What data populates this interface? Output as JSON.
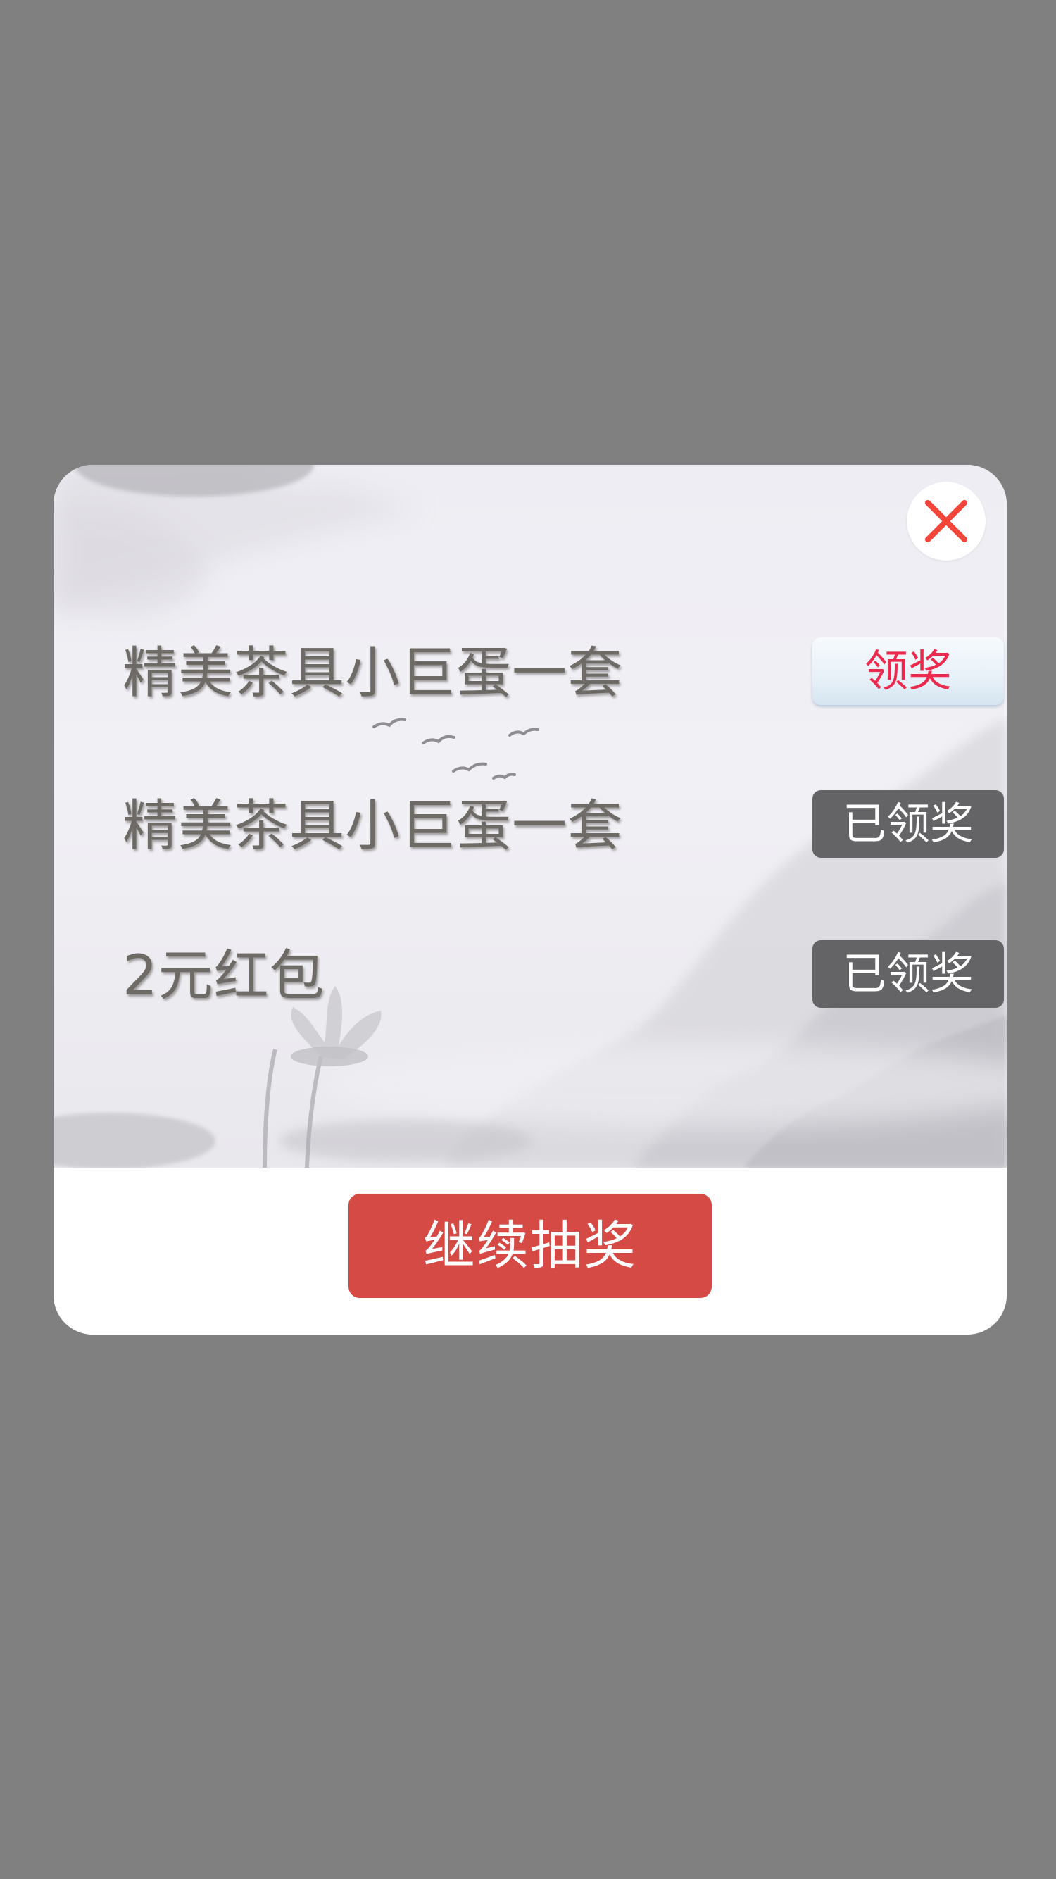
{
  "dialog": {
    "close_icon": "close-icon",
    "prizes": [
      {
        "name": "精美茶具小巨蛋一套",
        "button_label": "领奖",
        "state": "unclaimed"
      },
      {
        "name": "精美茶具小巨蛋一套",
        "button_label": "已领奖",
        "state": "claimed"
      },
      {
        "name": "2元红包",
        "button_label": "已领奖",
        "state": "claimed"
      }
    ],
    "continue_label": "继续抽奖"
  },
  "colors": {
    "overlay": "#808080",
    "close_x": "#f2463a",
    "claim_active_text": "#ec2a4d",
    "claimed_bg": "#646466",
    "continue_bg": "#d54a45"
  }
}
